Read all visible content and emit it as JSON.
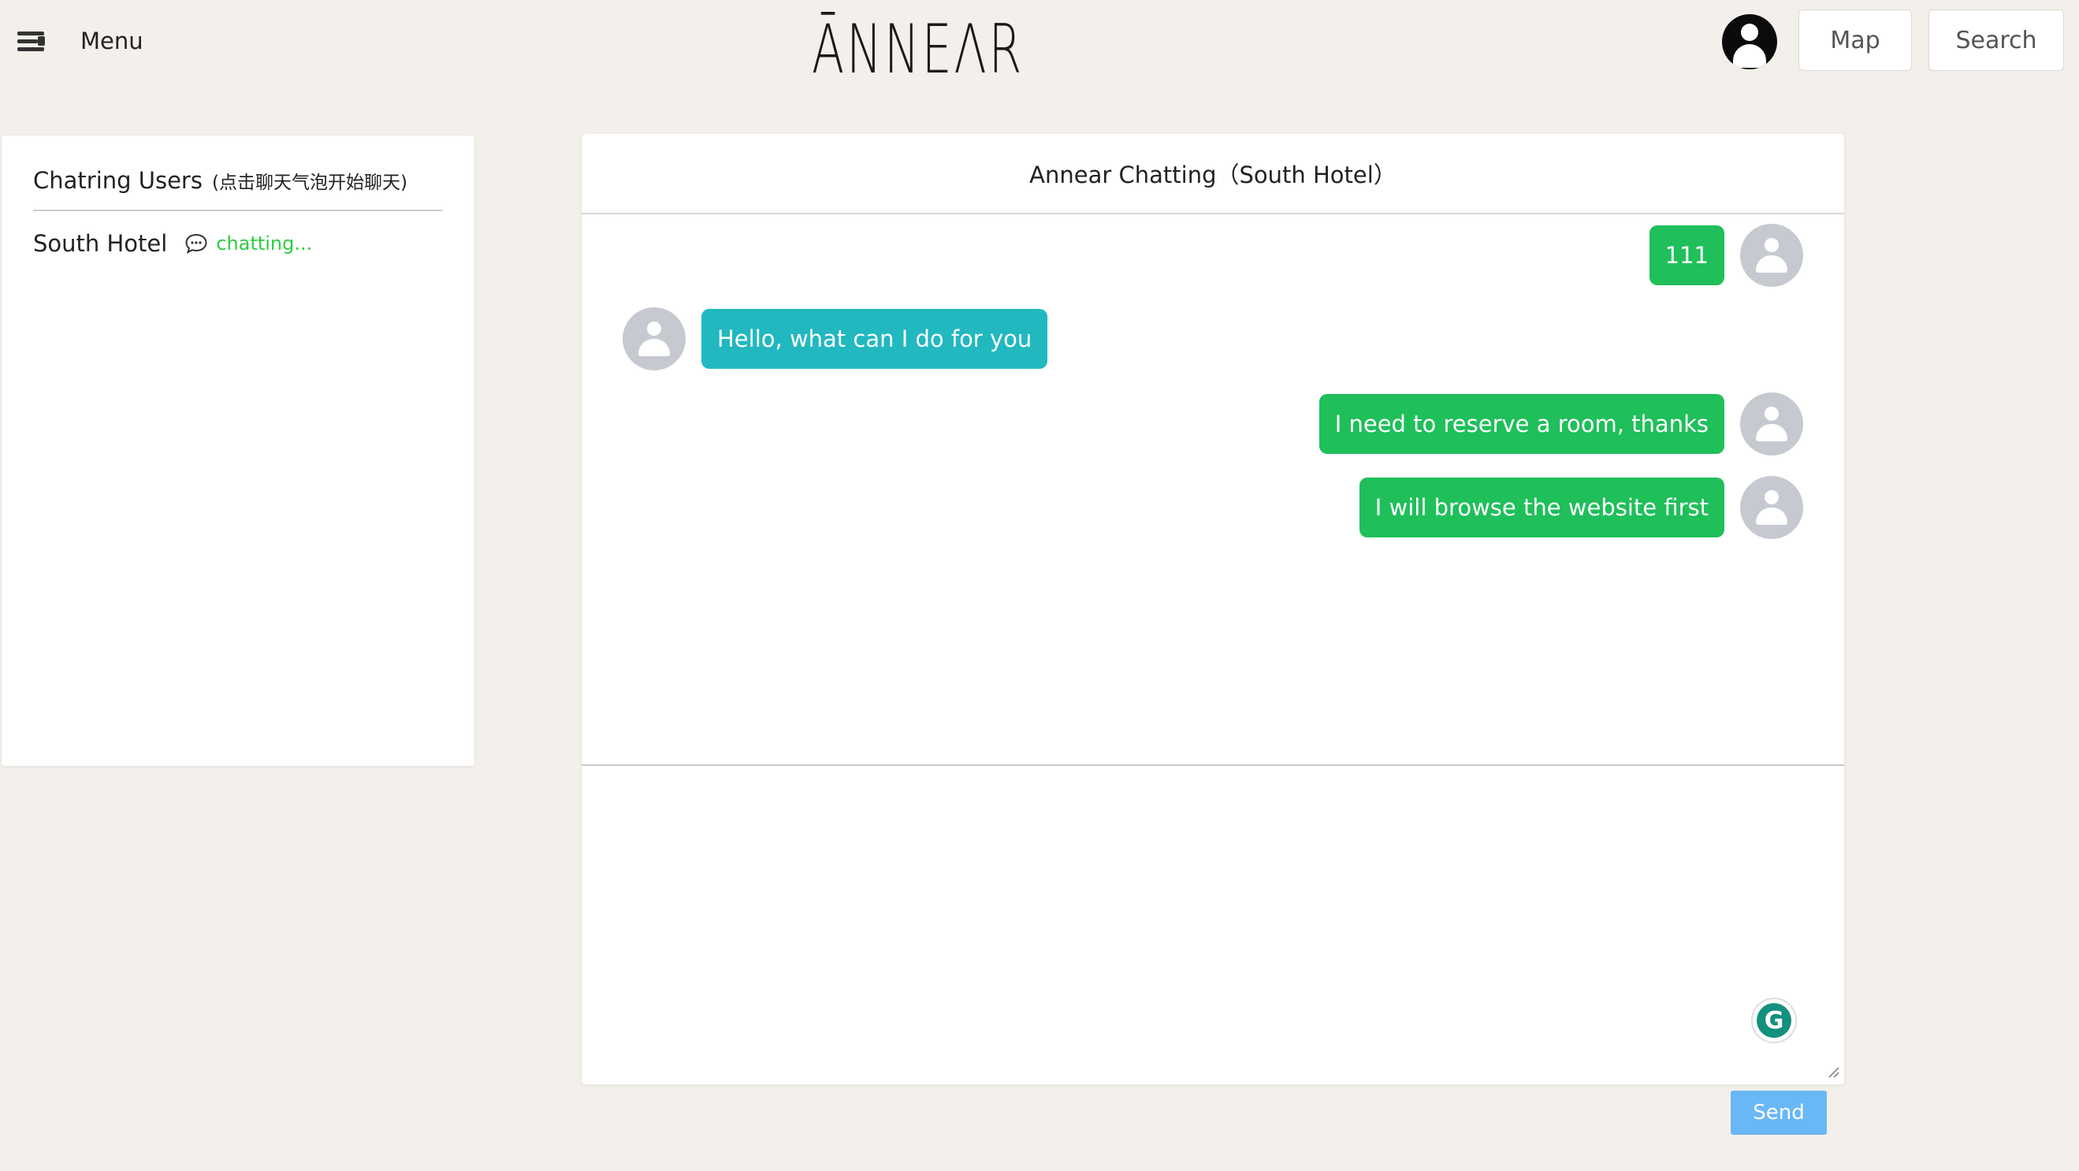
{
  "header": {
    "menu_label": "Menu",
    "logo_text": "ĀNNEΛR",
    "map_label": "Map",
    "search_label": "Search"
  },
  "sidebar": {
    "title": "Chatring Users",
    "hint": "(点击聊天气泡开始聊天)",
    "users": [
      {
        "name": "South Hotel",
        "status": "chatting..."
      }
    ]
  },
  "chat": {
    "title": "Annear Chatting（South Hotel）",
    "messages": [
      {
        "side": "right",
        "text": "111"
      },
      {
        "side": "left",
        "text": "Hello, what can I do for you"
      },
      {
        "side": "right",
        "text": "I need to reserve a room, thanks"
      },
      {
        "side": "right",
        "text": "I will browse the website first"
      }
    ],
    "input_value": "",
    "send_label": "Send",
    "grammarly_letter": "G"
  },
  "colors": {
    "background": "#f3efea",
    "my_bubble": "#1fbf5a",
    "their_bubble": "#22b8c0",
    "status_green": "#2ecc40",
    "send_button": "#6ab7f5"
  },
  "icons": {
    "menu": "hamburger-icon",
    "user": "user-account-icon",
    "chat": "chat-bubble-icon",
    "avatar": "default-avatar-icon",
    "grammarly": "grammarly-icon"
  }
}
